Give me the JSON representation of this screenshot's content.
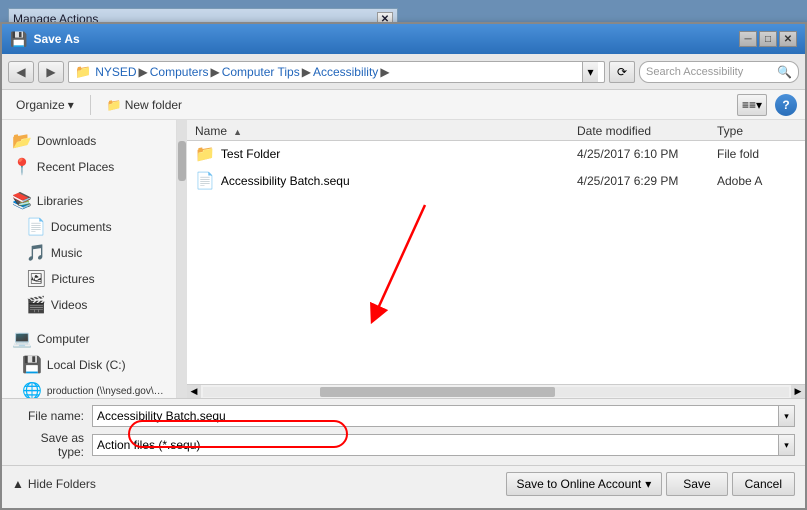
{
  "manageActions": {
    "title": "Manage Actions",
    "closeBtn": "✕"
  },
  "dialog": {
    "title": "Save As",
    "icon": "💾",
    "closeBtn": "✕",
    "minimizeBtn": "─",
    "maximizeBtn": "□"
  },
  "nav": {
    "backBtn": "◀",
    "forwardBtn": "▶",
    "folderIcon": "📁",
    "breadcrumb": [
      "NYSED",
      "Computers",
      "Computer Tips",
      "Accessibility"
    ],
    "refreshLabel": "⟳",
    "searchPlaceholder": "Search Accessibility",
    "searchIcon": "🔍"
  },
  "toolbar": {
    "organizeLabel": "Organize",
    "organizeDropdown": "▾",
    "newFolderLabel": "New folder",
    "viewLabel": "≡≡",
    "viewDropdown": "▾",
    "helpLabel": "?"
  },
  "sidebar": {
    "items": [
      {
        "icon": "📂",
        "label": "Downloads"
      },
      {
        "icon": "📍",
        "label": "Recent Places"
      },
      {
        "icon": "📚",
        "label": "Libraries"
      },
      {
        "icon": "📄",
        "label": "Documents"
      },
      {
        "icon": "🎵",
        "label": "Music"
      },
      {
        "icon": "🖼",
        "label": "Pictures"
      },
      {
        "icon": "🎬",
        "label": "Videos"
      },
      {
        "icon": "💻",
        "label": "Computer"
      },
      {
        "icon": "💾",
        "label": "Local Disk (C:)"
      },
      {
        "icon": "🌐",
        "label": "production (\\\\nysed.gov\\APP\\Applications\\RTTT-D"
      }
    ]
  },
  "fileList": {
    "columns": {
      "name": "Name",
      "dateModified": "Date modified",
      "type": "Type"
    },
    "sortIndicator": "▲",
    "files": [
      {
        "icon": "📁",
        "name": "Test Folder",
        "date": "4/25/2017 6:10 PM",
        "type": "File fold"
      },
      {
        "icon": "📄",
        "name": "Accessibility Batch.sequ",
        "date": "4/25/2017 6:29 PM",
        "type": "Adobe A"
      }
    ]
  },
  "bottomForm": {
    "fileNameLabel": "File name:",
    "fileNameValue": "Accessibility Batch.sequ",
    "saveTypeLabel": "Save as type:",
    "saveTypeValue": "Action files (*.sequ)"
  },
  "footer": {
    "hideFoldersIcon": "▲",
    "hideFoldersLabel": "Hide Folders",
    "saveOnlineLabel": "Save to Online Account",
    "saveOnlineDropdown": "▾",
    "saveLabel": "Save",
    "cancelLabel": "Cancel"
  }
}
